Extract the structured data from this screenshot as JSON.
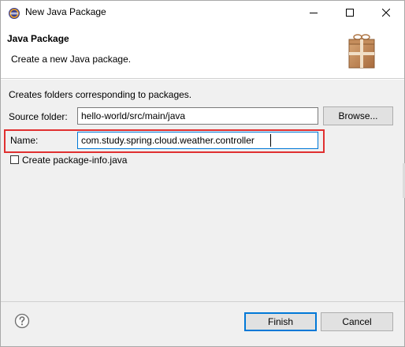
{
  "window": {
    "title": "New Java Package"
  },
  "header": {
    "title": "Java Package",
    "description": "Create a new Java package."
  },
  "body": {
    "description": "Creates folders corresponding to packages.",
    "source_folder": {
      "label": "Source folder:",
      "value": "hello-world/src/main/java",
      "browse_label": "Browse..."
    },
    "name": {
      "label": "Name:",
      "value": "com.study.spring.cloud.weather.controller"
    },
    "package_info": {
      "label": "Create package-info.java",
      "checked": false
    }
  },
  "footer": {
    "finish_label": "Finish",
    "cancel_label": "Cancel"
  },
  "colors": {
    "highlight": "#e03030",
    "accent": "#0078d7"
  },
  "icons": [
    "eclipse-app-icon",
    "minimize-icon",
    "maximize-icon",
    "close-icon",
    "package-gift-icon",
    "help-icon"
  ]
}
